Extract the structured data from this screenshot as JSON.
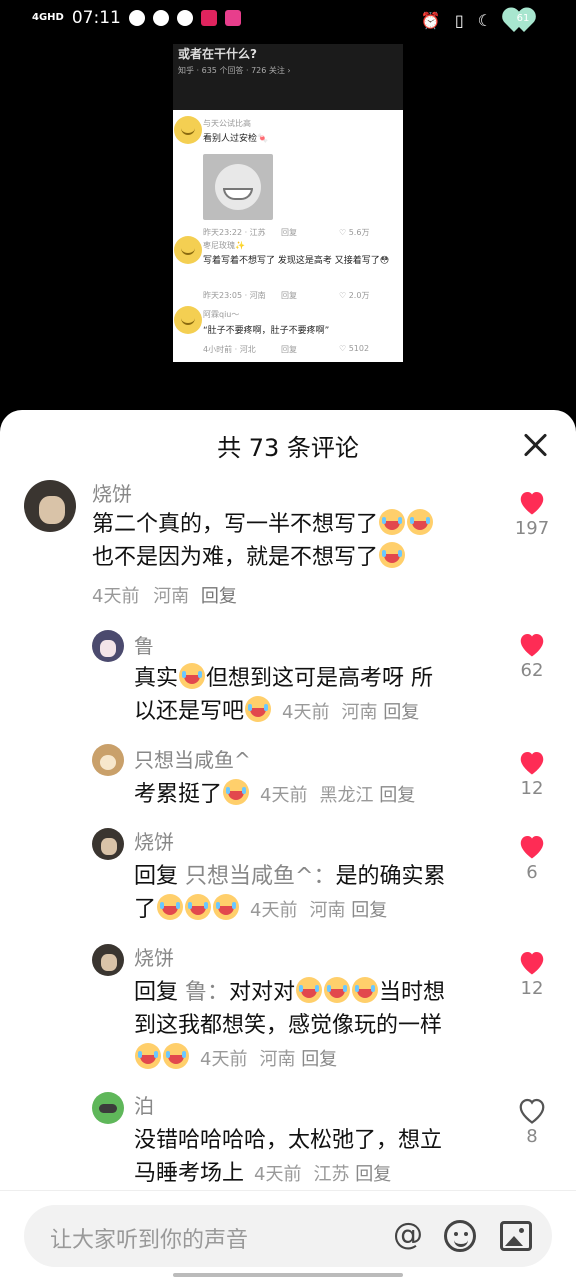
{
  "status_bar": {
    "network": "4GHD",
    "time": "07:11",
    "battery": "61"
  },
  "video": {
    "title": "或者在干什么?",
    "meta": "知乎 · 635 个回答 · 726 关注 ›",
    "comments": [
      {
        "name": "与天公试比高",
        "text": "看别人过安检🍬",
        "time": "昨天23:22 · 江苏",
        "reply": "回复",
        "likes": "♡ 5.6万"
      },
      {
        "name": "枣尼玫瑰✨",
        "text": "写着写着不想写了 发现这是高考 又接着写了😳",
        "time": "昨天23:05 · 河南",
        "reply": "回复",
        "likes": "♡ 2.0万"
      },
      {
        "name": "阿霖qiu～",
        "text": "“肚子不要疼啊，肚子不要疼啊”",
        "time": "4小时前 · 河北",
        "reply": "回复",
        "likes": "♡ 5102"
      }
    ]
  },
  "sheet": {
    "title": "共 73 条评论"
  },
  "comments": [
    {
      "user": "烧饼",
      "lines": [
        "第二个真的，写一半不想写了",
        "也不是因为难，就是不想写了"
      ],
      "time": "4天前",
      "region": "河南",
      "reply": "回复",
      "likes": "197",
      "liked": true
    },
    {
      "user": "鲁",
      "lines": [
        "真实",
        "但想到这可是高考呀 所",
        "以还是写吧"
      ],
      "time": "4天前",
      "region": "河南",
      "reply": "回复",
      "likes": "62",
      "liked": true
    },
    {
      "user": "只想当咸鱼^",
      "lines": [
        "考累挺了"
      ],
      "time": "4天前",
      "region": "黑龙江",
      "reply": "回复",
      "likes": "12",
      "liked": true
    },
    {
      "user": "烧饼",
      "prefix": "回复",
      "mention": "只想当咸鱼^：",
      "lines": [
        "是的确实累",
        "了"
      ],
      "time": "4天前",
      "region": "河南",
      "reply": "回复",
      "likes": "6",
      "liked": true
    },
    {
      "user": "烧饼",
      "prefix": "回复",
      "mention": "鲁：",
      "lines": [
        "对对对",
        "当时想",
        "到这我都想笑，感觉像玩的一样"
      ],
      "time": "4天前",
      "region": "河南",
      "reply": "回复",
      "likes": "12",
      "liked": true
    },
    {
      "user": "泊",
      "lines": [
        "没错哈哈哈哈，太松弛了，想立",
        "马睡考场上"
      ],
      "time": "4天前",
      "region": "江苏",
      "reply": "回复",
      "likes": "8",
      "liked": false
    }
  ],
  "input": {
    "placeholder": "让大家听到你的声音",
    "at_symbol": "@"
  },
  "icons": {
    "close": "close-icon",
    "like": "heart-icon",
    "mention": "at-icon",
    "emoji": "smile-icon",
    "image": "image-icon"
  },
  "colors": {
    "like_red": "#fe2c55",
    "muted_text": "#888888"
  }
}
